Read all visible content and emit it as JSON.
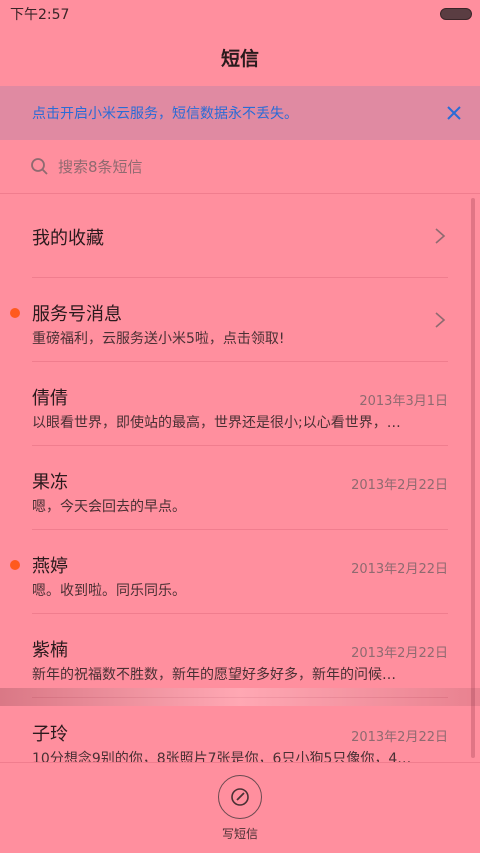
{
  "status": {
    "time": "下午2:57"
  },
  "header": {
    "title": "短信"
  },
  "banner": {
    "text": "点击开启小米云服务，短信数据永不丢失。",
    "close_icon": "close-icon"
  },
  "search": {
    "placeholder": "搜索8条短信"
  },
  "list": {
    "favorites": {
      "title": "我的收藏"
    },
    "items": [
      {
        "title": "服务号消息",
        "snippet": "重磅福利，云服务送小米5啦，点击领取!",
        "date": "",
        "unread": true
      },
      {
        "title": "倩倩",
        "snippet": "以眼看世界，即使站的最高，世界还是很小;以心看世界，…",
        "date": "2013年3月1日",
        "unread": false
      },
      {
        "title": "果冻",
        "snippet": "嗯，今天会回去的早点。",
        "date": "2013年2月22日",
        "unread": false
      },
      {
        "title": "燕婷",
        "snippet": "嗯。收到啦。同乐同乐。",
        "date": "2013年2月22日",
        "unread": true
      },
      {
        "title": "紫楠",
        "snippet": "新年的祝福数不胜数，新年的愿望好多好多，新年的问候…",
        "date": "2013年2月22日",
        "unread": false
      },
      {
        "title": "子玲",
        "snippet": "10分想念9别的你，8张照片7张是你，6只小狗5只像你，4…",
        "date": "2013年2月22日",
        "unread": false
      }
    ]
  },
  "compose": {
    "label": "写短信"
  },
  "colors": {
    "accent_blue": "#2a6bd6",
    "unread_dot": "#ff5a1f",
    "background": "#ff8f9e"
  }
}
